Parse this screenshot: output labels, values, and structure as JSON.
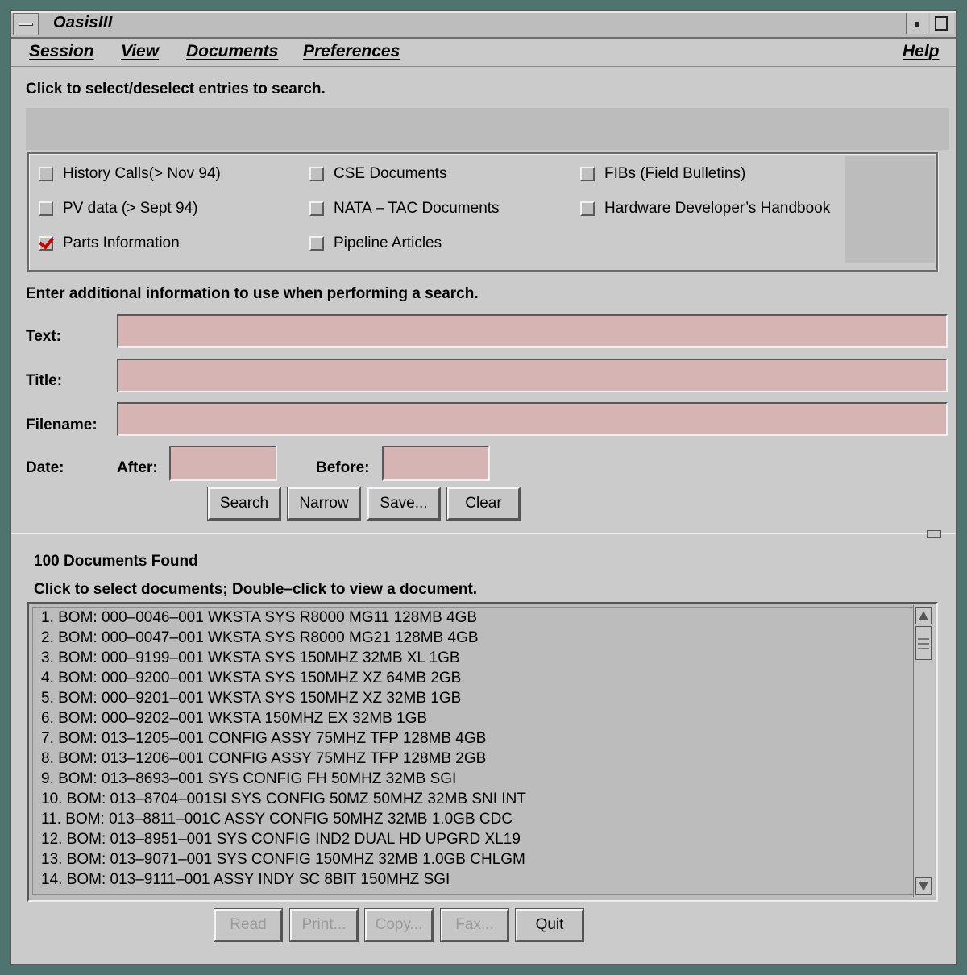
{
  "window": {
    "title": "OasisIII"
  },
  "menu": {
    "session": "Session",
    "view": "View",
    "documents": "Documents",
    "preferences": "Preferences",
    "help": "Help"
  },
  "search_section": {
    "instruction": "Click to select/deselect entries to search.",
    "entries": [
      {
        "label": "History Calls(> Nov 94)",
        "checked": false
      },
      {
        "label": "CSE Documents",
        "checked": false
      },
      {
        "label": "FIBs (Field Bulletins)",
        "checked": false
      },
      {
        "label": "PV data (> Sept 94)",
        "checked": false
      },
      {
        "label": "NATA – TAC Documents",
        "checked": false
      },
      {
        "label": "Hardware Developer’s Handbook",
        "checked": false
      },
      {
        "label": "Parts Information",
        "checked": true
      },
      {
        "label": "Pipeline Articles",
        "checked": false
      }
    ]
  },
  "additional": {
    "instruction": "Enter additional information to use when performing a search.",
    "text_label": "Text:",
    "title_label": "Title:",
    "filename_label": "Filename:",
    "date_label": "Date:",
    "after_label": "After:",
    "before_label": "Before:",
    "text_value": "",
    "title_value": "",
    "filename_value": "",
    "after_value": "",
    "before_value": ""
  },
  "actions": {
    "search": "Search",
    "narrow": "Narrow",
    "save": "Save...",
    "clear": "Clear"
  },
  "results": {
    "count_text": "100 Documents Found",
    "instruction": "Click to select documents; Double–click to view a document.",
    "items": [
      "1.  BOM: 000–0046–001 WKSTA SYS R8000 MG11 128MB 4GB",
      "2.  BOM: 000–0047–001 WKSTA SYS R8000 MG21 128MB 4GB",
      "3.  BOM: 000–9199–001 WKSTA SYS 150MHZ 32MB XL 1GB",
      "4.  BOM: 000–9200–001 WKSTA SYS 150MHZ XZ 64MB 2GB",
      "5.  BOM: 000–9201–001 WKSTA SYS 150MHZ XZ 32MB 1GB",
      "6.  BOM: 000–9202–001 WKSTA 150MHZ EX 32MB 1GB",
      "7.  BOM: 013–1205–001 CONFIG ASSY 75MHZ TFP 128MB 4GB",
      "8.  BOM: 013–1206–001 CONFIG ASSY 75MHZ TFP 128MB 2GB",
      "9.  BOM: 013–8693–001 SYS CONFIG FH 50MHZ 32MB SGI",
      "10.  BOM: 013–8704–001SI SYS CONFIG 50MZ 50MHZ 32MB SNI INT",
      "11.  BOM: 013–8811–001C ASSY CONFIG 50MHZ 32MB 1.0GB CDC",
      "12.  BOM: 013–8951–001 SYS CONFIG IND2 DUAL HD UPGRD XL19",
      "13.  BOM: 013–9071–001 SYS CONFIG 150MHZ 32MB 1.0GB CHLGM",
      "14.  BOM: 013–9111–001 ASSY INDY SC 8BIT 150MHZ SGI"
    ]
  },
  "bottom_actions": {
    "read": "Read",
    "print": "Print...",
    "copy": "Copy...",
    "fax": "Fax...",
    "quit": "Quit"
  }
}
